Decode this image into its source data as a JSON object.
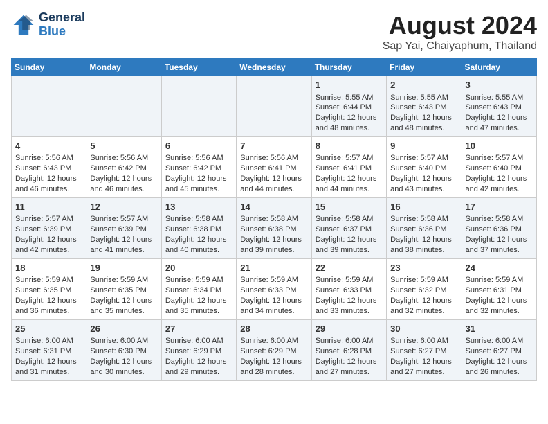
{
  "header": {
    "logo_line1": "General",
    "logo_line2": "Blue",
    "month_title": "August 2024",
    "subtitle": "Sap Yai, Chaiyaphum, Thailand"
  },
  "weekdays": [
    "Sunday",
    "Monday",
    "Tuesday",
    "Wednesday",
    "Thursday",
    "Friday",
    "Saturday"
  ],
  "weeks": [
    [
      {
        "day": "",
        "info": ""
      },
      {
        "day": "",
        "info": ""
      },
      {
        "day": "",
        "info": ""
      },
      {
        "day": "",
        "info": ""
      },
      {
        "day": "1",
        "info": "Sunrise: 5:55 AM\nSunset: 6:44 PM\nDaylight: 12 hours\nand 48 minutes."
      },
      {
        "day": "2",
        "info": "Sunrise: 5:55 AM\nSunset: 6:43 PM\nDaylight: 12 hours\nand 48 minutes."
      },
      {
        "day": "3",
        "info": "Sunrise: 5:55 AM\nSunset: 6:43 PM\nDaylight: 12 hours\nand 47 minutes."
      }
    ],
    [
      {
        "day": "4",
        "info": "Sunrise: 5:56 AM\nSunset: 6:43 PM\nDaylight: 12 hours\nand 46 minutes."
      },
      {
        "day": "5",
        "info": "Sunrise: 5:56 AM\nSunset: 6:42 PM\nDaylight: 12 hours\nand 46 minutes."
      },
      {
        "day": "6",
        "info": "Sunrise: 5:56 AM\nSunset: 6:42 PM\nDaylight: 12 hours\nand 45 minutes."
      },
      {
        "day": "7",
        "info": "Sunrise: 5:56 AM\nSunset: 6:41 PM\nDaylight: 12 hours\nand 44 minutes."
      },
      {
        "day": "8",
        "info": "Sunrise: 5:57 AM\nSunset: 6:41 PM\nDaylight: 12 hours\nand 44 minutes."
      },
      {
        "day": "9",
        "info": "Sunrise: 5:57 AM\nSunset: 6:40 PM\nDaylight: 12 hours\nand 43 minutes."
      },
      {
        "day": "10",
        "info": "Sunrise: 5:57 AM\nSunset: 6:40 PM\nDaylight: 12 hours\nand 42 minutes."
      }
    ],
    [
      {
        "day": "11",
        "info": "Sunrise: 5:57 AM\nSunset: 6:39 PM\nDaylight: 12 hours\nand 42 minutes."
      },
      {
        "day": "12",
        "info": "Sunrise: 5:57 AM\nSunset: 6:39 PM\nDaylight: 12 hours\nand 41 minutes."
      },
      {
        "day": "13",
        "info": "Sunrise: 5:58 AM\nSunset: 6:38 PM\nDaylight: 12 hours\nand 40 minutes."
      },
      {
        "day": "14",
        "info": "Sunrise: 5:58 AM\nSunset: 6:38 PM\nDaylight: 12 hours\nand 39 minutes."
      },
      {
        "day": "15",
        "info": "Sunrise: 5:58 AM\nSunset: 6:37 PM\nDaylight: 12 hours\nand 39 minutes."
      },
      {
        "day": "16",
        "info": "Sunrise: 5:58 AM\nSunset: 6:36 PM\nDaylight: 12 hours\nand 38 minutes."
      },
      {
        "day": "17",
        "info": "Sunrise: 5:58 AM\nSunset: 6:36 PM\nDaylight: 12 hours\nand 37 minutes."
      }
    ],
    [
      {
        "day": "18",
        "info": "Sunrise: 5:59 AM\nSunset: 6:35 PM\nDaylight: 12 hours\nand 36 minutes."
      },
      {
        "day": "19",
        "info": "Sunrise: 5:59 AM\nSunset: 6:35 PM\nDaylight: 12 hours\nand 35 minutes."
      },
      {
        "day": "20",
        "info": "Sunrise: 5:59 AM\nSunset: 6:34 PM\nDaylight: 12 hours\nand 35 minutes."
      },
      {
        "day": "21",
        "info": "Sunrise: 5:59 AM\nSunset: 6:33 PM\nDaylight: 12 hours\nand 34 minutes."
      },
      {
        "day": "22",
        "info": "Sunrise: 5:59 AM\nSunset: 6:33 PM\nDaylight: 12 hours\nand 33 minutes."
      },
      {
        "day": "23",
        "info": "Sunrise: 5:59 AM\nSunset: 6:32 PM\nDaylight: 12 hours\nand 32 minutes."
      },
      {
        "day": "24",
        "info": "Sunrise: 5:59 AM\nSunset: 6:31 PM\nDaylight: 12 hours\nand 32 minutes."
      }
    ],
    [
      {
        "day": "25",
        "info": "Sunrise: 6:00 AM\nSunset: 6:31 PM\nDaylight: 12 hours\nand 31 minutes."
      },
      {
        "day": "26",
        "info": "Sunrise: 6:00 AM\nSunset: 6:30 PM\nDaylight: 12 hours\nand 30 minutes."
      },
      {
        "day": "27",
        "info": "Sunrise: 6:00 AM\nSunset: 6:29 PM\nDaylight: 12 hours\nand 29 minutes."
      },
      {
        "day": "28",
        "info": "Sunrise: 6:00 AM\nSunset: 6:29 PM\nDaylight: 12 hours\nand 28 minutes."
      },
      {
        "day": "29",
        "info": "Sunrise: 6:00 AM\nSunset: 6:28 PM\nDaylight: 12 hours\nand 27 minutes."
      },
      {
        "day": "30",
        "info": "Sunrise: 6:00 AM\nSunset: 6:27 PM\nDaylight: 12 hours\nand 27 minutes."
      },
      {
        "day": "31",
        "info": "Sunrise: 6:00 AM\nSunset: 6:27 PM\nDaylight: 12 hours\nand 26 minutes."
      }
    ]
  ]
}
